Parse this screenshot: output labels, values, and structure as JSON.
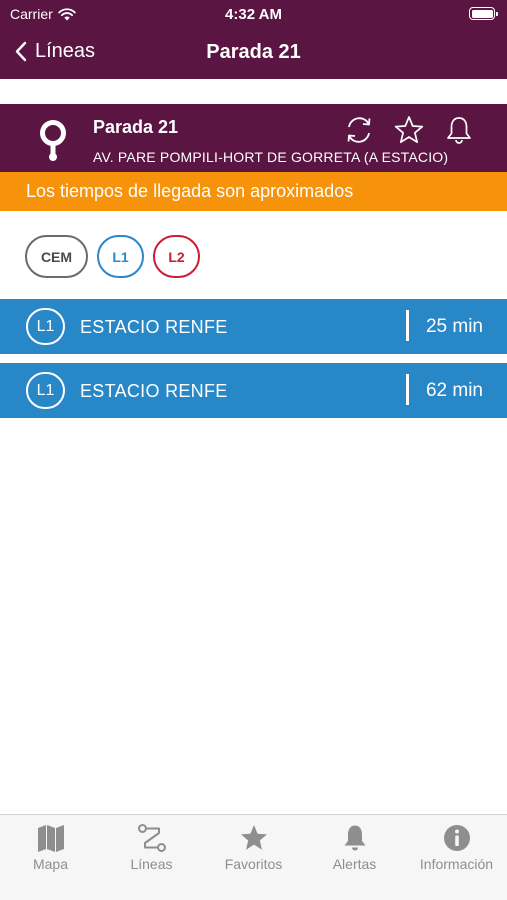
{
  "status_bar": {
    "carrier": "Carrier",
    "time": "4:32 AM"
  },
  "nav": {
    "back_label": "Líneas",
    "title": "Parada 21"
  },
  "stop": {
    "name": "Parada 21",
    "address": "AV. PARE POMPILI-HORT DE GORRETA (A ESTACIO)"
  },
  "notice": "Los tiempos de llegada son aproximados",
  "lines": [
    {
      "label": "CEM",
      "color": "#6b6b6b"
    },
    {
      "label": "L1",
      "color": "#2d86c9"
    },
    {
      "label": "L2",
      "color": "#c81d34"
    }
  ],
  "arrivals": [
    {
      "line": "L1",
      "destination": "ESTACIO RENFE",
      "time": "25 min"
    },
    {
      "line": "L1",
      "destination": "ESTACIO RENFE",
      "time": "62 min"
    }
  ],
  "tabs": [
    {
      "label": "Mapa",
      "icon": "map-icon"
    },
    {
      "label": "Líneas",
      "icon": "route-icon"
    },
    {
      "label": "Favoritos",
      "icon": "star-icon"
    },
    {
      "label": "Alertas",
      "icon": "bell-icon"
    },
    {
      "label": "Información",
      "icon": "info-icon"
    }
  ],
  "colors": {
    "brand": "#5b1543",
    "notice": "#f7930b",
    "arrival": "#2787c7",
    "tab_inactive": "#8e8e8e"
  }
}
